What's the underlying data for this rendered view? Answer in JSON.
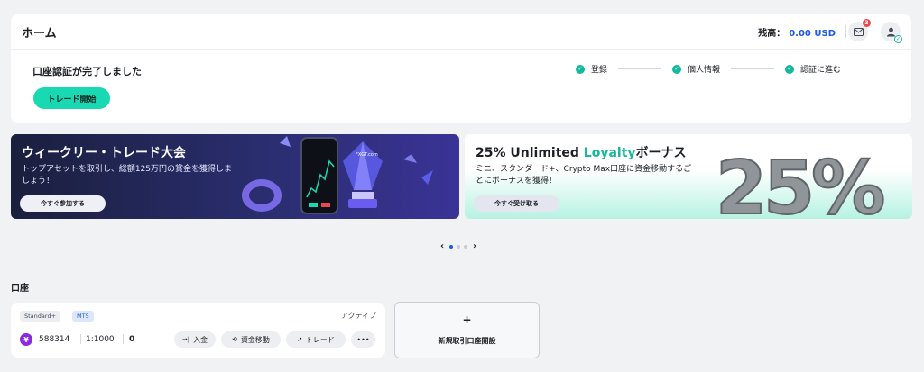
{
  "header": {
    "title": "ホーム",
    "balance_label": "残高：",
    "balance_value": "0.00 USD",
    "mail_badge": "3",
    "icons": [
      "mail-icon",
      "user-icon",
      "check-icon"
    ]
  },
  "verification": {
    "title": "口座認証が完了しました",
    "trade_button": "トレード開始",
    "steps": [
      {
        "label": "登録"
      },
      {
        "label": "個人情報"
      },
      {
        "label": "認証に進む"
      }
    ]
  },
  "banners": [
    {
      "title": "ウィークリー・トレード大会",
      "subtitle": "トップアセットを取引し、総額125万円の賞金を獲得しましょう！",
      "button": "今すぐ参加する",
      "art_label": "FXGT.com"
    },
    {
      "title_prefix": "25% Unlimited ",
      "title_brand": "Loyalty",
      "title_suffix": "ボーナス",
      "subtitle": "ミニ、スタンダード+、Crypto Max口座に資金移動するごとにボーナスを獲得！",
      "button": "今すぐ受け取る",
      "art_text": "25%"
    }
  ],
  "carousel": {
    "prev": "‹",
    "next": "›",
    "dot_count": 3,
    "active_index": 0
  },
  "accounts": {
    "section_title": "口座",
    "card": {
      "type_tag": "Standard+",
      "platform_tag": "MT5",
      "status": "アクティブ",
      "currency_symbol": "¥",
      "number": "588314",
      "leverage": "1:1000",
      "balance": "0",
      "actions": {
        "deposit": "入金",
        "transfer": "資金移動",
        "trade": "トレード",
        "more": "•••"
      }
    },
    "new_account": {
      "plus": "+",
      "label": "新規取引口座開設"
    }
  },
  "colors": {
    "accent_teal": "#19d9b3",
    "brand_blue": "#1e5ae6",
    "badge_red": "#e5484d",
    "yen_purple": "#8a2be2"
  }
}
